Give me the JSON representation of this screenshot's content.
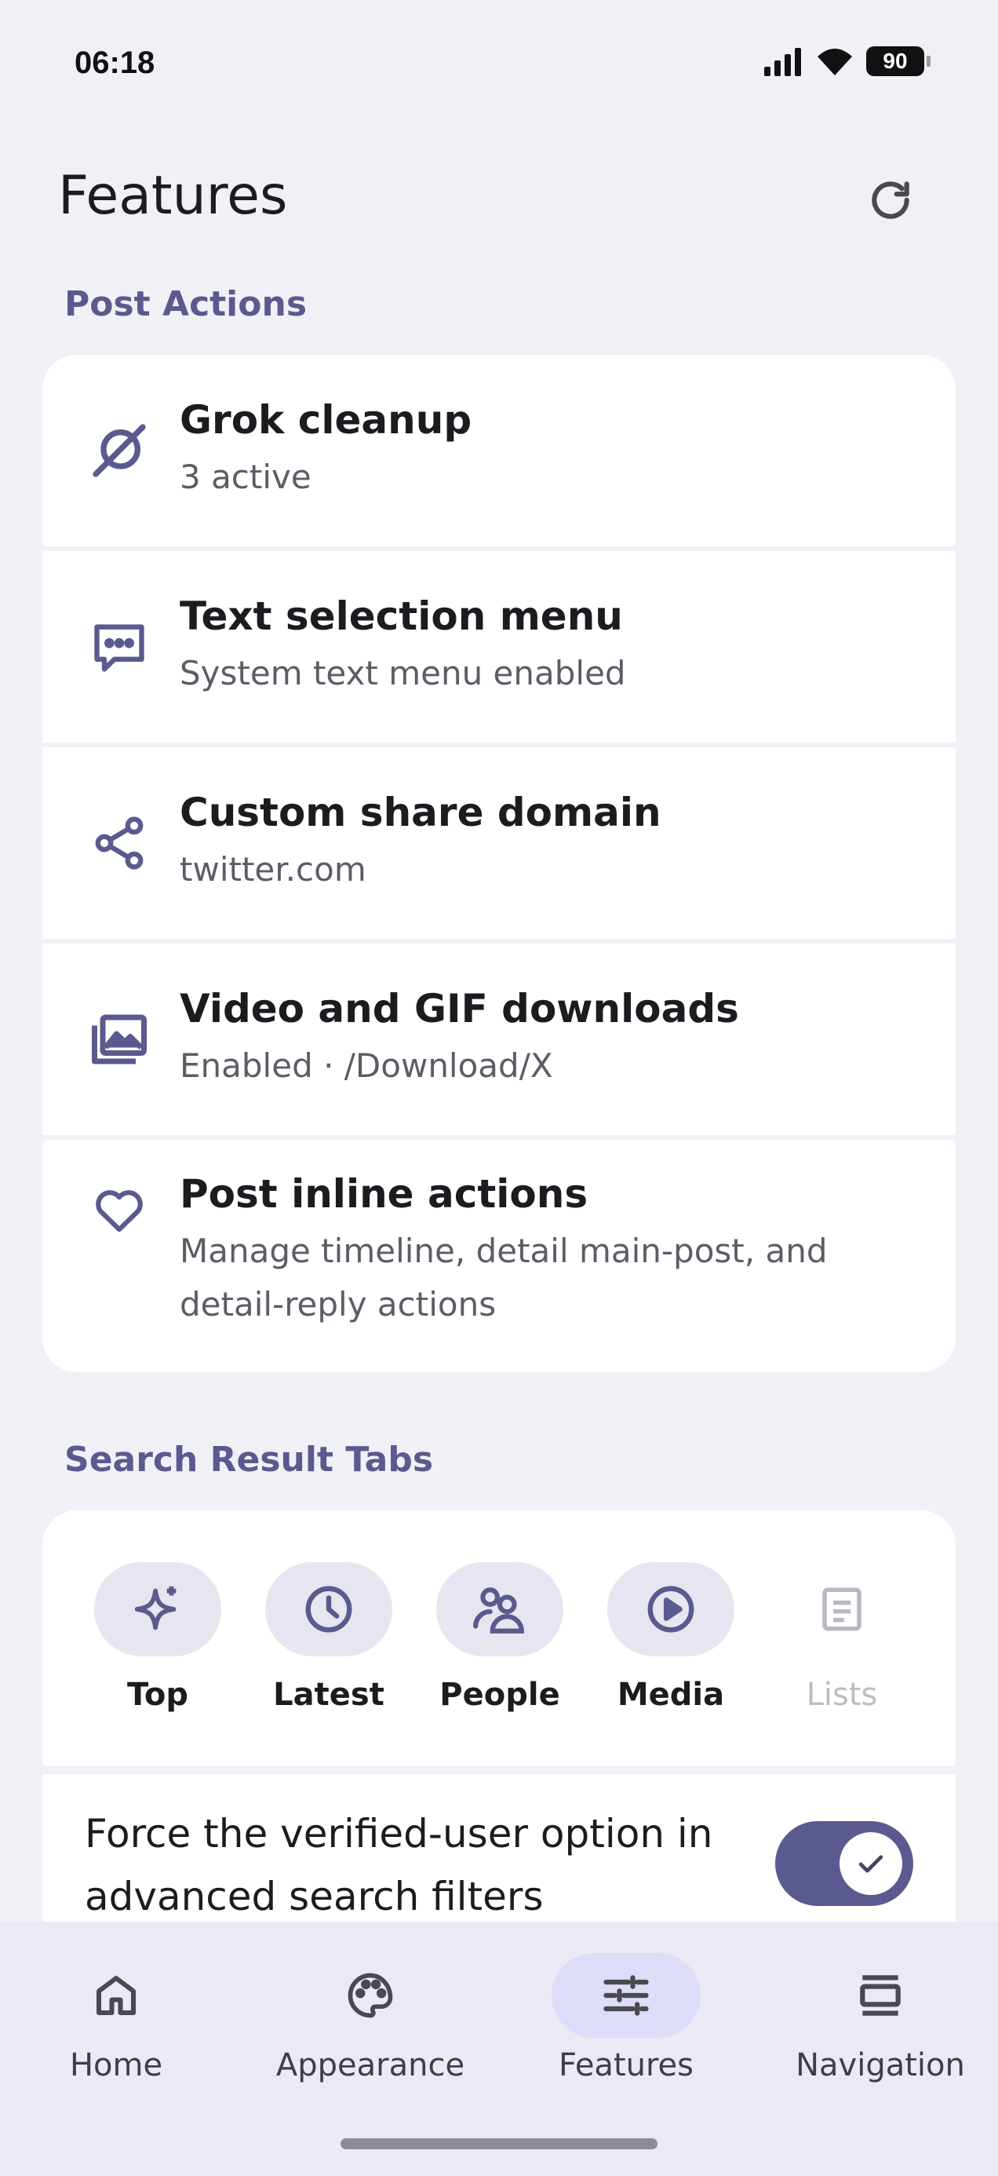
{
  "status_bar": {
    "time": "06:18",
    "battery": "90"
  },
  "header": {
    "title": "Features"
  },
  "sections": {
    "post_actions": {
      "label": "Post Actions",
      "items": [
        {
          "title": "Grok cleanup",
          "subtitle": "3 active",
          "icon": "grok-icon"
        },
        {
          "title": "Text selection menu",
          "subtitle": "System text menu enabled",
          "icon": "message-dots-icon"
        },
        {
          "title": "Custom share domain",
          "subtitle": "twitter.com",
          "icon": "share-icon"
        },
        {
          "title": "Video and GIF downloads",
          "subtitle": "Enabled · /Download/X",
          "icon": "photo-library-icon"
        },
        {
          "title": "Post inline actions",
          "subtitle": "Manage timeline, detail main-post, and detail-reply actions",
          "icon": "heart-icon"
        }
      ]
    },
    "search_tabs": {
      "label": "Search Result Tabs",
      "tabs": [
        {
          "label": "Top",
          "icon": "sparkle-icon",
          "enabled": true
        },
        {
          "label": "Latest",
          "icon": "clock-icon",
          "enabled": true
        },
        {
          "label": "People",
          "icon": "people-icon",
          "enabled": true
        },
        {
          "label": "Media",
          "icon": "play-icon",
          "enabled": true
        },
        {
          "label": "Lists",
          "icon": "list-doc-icon",
          "enabled": false
        }
      ],
      "toggle": {
        "label": "Force the verified-user option in advanced search filters",
        "on": true
      }
    }
  },
  "bottom_nav": {
    "items": [
      {
        "label": "Home",
        "icon": "home-icon"
      },
      {
        "label": "Appearance",
        "icon": "palette-icon"
      },
      {
        "label": "Features",
        "icon": "sliders-icon",
        "active": true
      },
      {
        "label": "Navigation",
        "icon": "navigation-icon"
      }
    ]
  },
  "colors": {
    "accent": "#5a5a8f",
    "background": "#f2f0f7",
    "card": "#ffffff",
    "active_pill": "#dddcf9"
  }
}
